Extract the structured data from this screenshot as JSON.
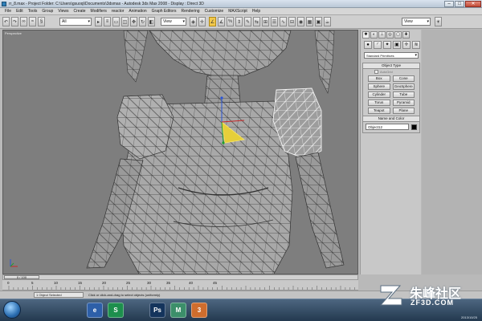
{
  "window": {
    "title": "rr_8.max    - Project Folder: C:\\Users\\gsuoqi\\Documents\\3dsmax     - Autodesk 3ds Max 2008     - Display : Direct 3D",
    "minimize": "–",
    "maximize": "□",
    "close": "✕"
  },
  "menu": [
    "File",
    "Edit",
    "Tools",
    "Group",
    "Views",
    "Create",
    "Modifiers",
    "reactor",
    "Animation",
    "Graph Editors",
    "Rendering",
    "Customize",
    "MAXScript",
    "Help"
  ],
  "toolbar": {
    "selection_filter": "All",
    "coord_system": "View",
    "named_selection": "View"
  },
  "viewport": {
    "label": "Perspective"
  },
  "command_panel": {
    "category_dropdown": "Standard Primitives",
    "object_type_title": "Object Type",
    "autogrid_label": "AutoGrid",
    "primitives": [
      "Box",
      "Cone",
      "Sphere",
      "GeoSphere",
      "Cylinder",
      "Tube",
      "Torus",
      "Pyramid",
      "Teapot",
      "Plane"
    ],
    "name_color_title": "Name and Color",
    "object_name": "Object12",
    "object_color": "#000000"
  },
  "timeline": {
    "current_frame": "0 / 100",
    "tick_labels": [
      "0",
      "5",
      "10",
      "15",
      "20",
      "25",
      "30",
      "35",
      "40",
      "45"
    ]
  },
  "status": {
    "selection": "1 Object Selected",
    "prompt": "Click or click-and-drag to select objects (uniformly)"
  },
  "taskbar": {
    "apps": [
      "e",
      "S",
      "Ps",
      "M",
      "3"
    ],
    "date": "2013/10/25"
  },
  "watermark": {
    "title": "朱峰社区",
    "url": "ZF3D.COM"
  }
}
